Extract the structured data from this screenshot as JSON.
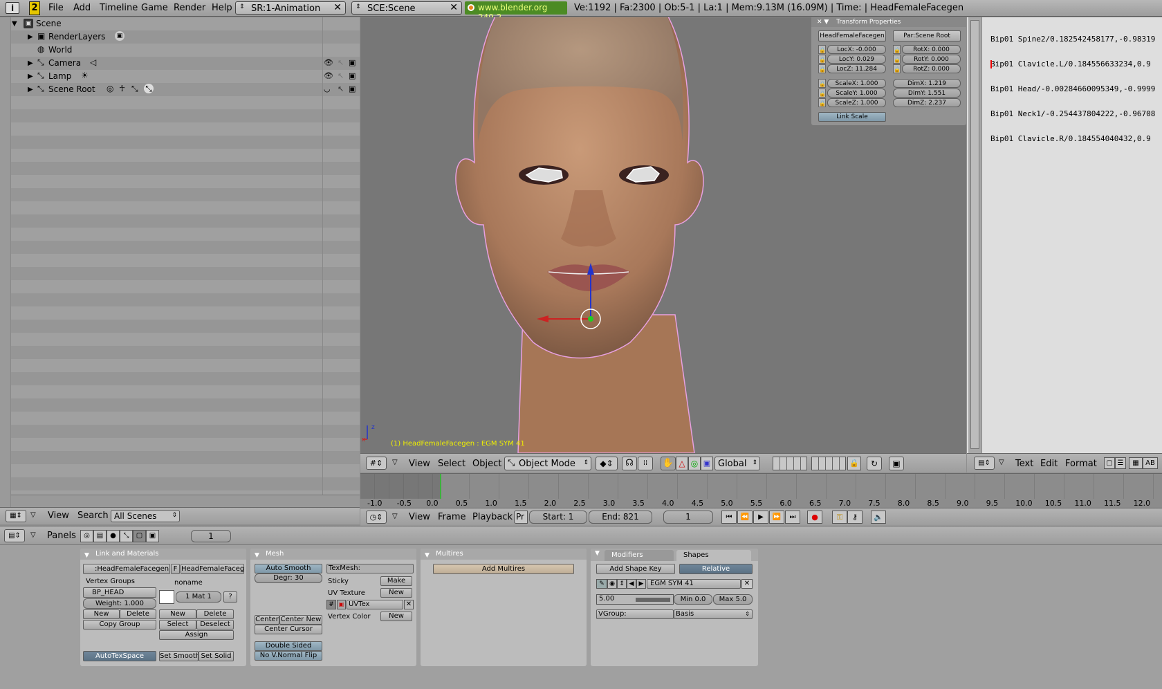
{
  "topbar": {
    "menus": [
      "File",
      "Add",
      "Timeline",
      "Game",
      "Render",
      "Help"
    ],
    "screen": "SR:1-Animation",
    "scene": "SCE:Scene",
    "version": "www.blender.org 249.2",
    "stats": "Ve:1192 | Fa:2300 | Ob:5-1 | La:1  | Mem:9.13M (16.09M)  | Time: | HeadFemaleFacegen"
  },
  "outliner": {
    "scene": "Scene",
    "items": [
      "RenderLayers",
      "World",
      "Camera",
      "Lamp",
      "Scene Root"
    ],
    "header": {
      "view": "View",
      "search": "Search",
      "filter": "All Scenes"
    }
  },
  "viewport": {
    "status": "(1) HeadFemaleFacegen : EGM SYM 41",
    "axis_z": "z",
    "axis_x": "x",
    "header": {
      "view": "View",
      "select": "Select",
      "object": "Object",
      "mode": "Object Mode",
      "orientation": "Global"
    }
  },
  "transform": {
    "title": "Transform Properties",
    "object": "HeadFemaleFacegen",
    "parent": "Par:Scene Root",
    "loc": [
      "LocX: -0.000",
      "LocY: 0.029",
      "LocZ: 11.284"
    ],
    "rot": [
      "RotX: 0.000",
      "RotY: 0.000",
      "RotZ: 0.000"
    ],
    "scale": [
      "ScaleX: 1.000",
      "ScaleY: 1.000",
      "ScaleZ: 1.000"
    ],
    "dim": [
      "DimX: 1.219",
      "DimY: 1.551",
      "DimZ: 2.237"
    ],
    "link_scale": "Link Scale"
  },
  "text_editor": {
    "lines": [
      "Bip01 Spine2/0.182542458177,-0.98319",
      "Bip01 Clavicle.L/0.184556633234,0.9",
      "Bip01 Head/-0.00284660095349,-0.9999",
      "Bip01 Neck1/-0.254437804222,-0.96708",
      "Bip01 Clavicle.R/0.184554040432,0.9"
    ],
    "header": {
      "text": "Text",
      "edit": "Edit",
      "format": "Format",
      "ab": "AB"
    }
  },
  "timeline": {
    "ticks": [
      "-1.0",
      "-0.5",
      "0.0",
      "0.5",
      "1.0",
      "1.5",
      "2.0",
      "2.5",
      "3.0",
      "3.5",
      "4.0",
      "4.5",
      "5.0",
      "5.5",
      "6.0",
      "6.5",
      "7.0",
      "7.5",
      "8.0",
      "8.5",
      "9.0",
      "9.5",
      "10.0",
      "10.5",
      "11.0",
      "11.5",
      "12.0"
    ],
    "current_frame_value": 0.1,
    "header": {
      "view": "View",
      "frame": "Frame",
      "playback": "Playback",
      "pr": "Pr",
      "start": "Start: 1",
      "end": "End: 821",
      "current": "1"
    }
  },
  "buttons_header": {
    "panels": "Panels",
    "frame": "1"
  },
  "link_materials": {
    "title": "Link and Materials",
    "mesh": ":HeadFemaleFacegen",
    "f": "F",
    "object": "HeadFemaleFacegen",
    "vgroups_label": "Vertex Groups",
    "vgroup": "BP_HEAD",
    "weight": "Weight: 1.000",
    "noname": "noname",
    "mat": "1 Mat 1",
    "q": "?",
    "new1": "New",
    "delete1": "Delete",
    "copy_group": "Copy Group",
    "new2": "New",
    "delete2": "Delete",
    "select": "Select",
    "deselect": "Deselect",
    "assign": "Assign",
    "autotex": "AutoTexSpace",
    "set_smooth": "Set Smooth",
    "set_solid": "Set Solid"
  },
  "mesh_panel": {
    "title": "Mesh",
    "auto_smooth": "Auto Smooth",
    "degr": "Degr: 30",
    "texmesh": "TexMesh:",
    "sticky": "Sticky",
    "make": "Make",
    "uv_texture": "UV Texture",
    "new_uv": "New",
    "uvtex": "UVTex",
    "vertex_color": "Vertex Color",
    "new_vc": "New",
    "center": "Center",
    "center_new": "Center New",
    "center_cursor": "Center Cursor",
    "double_sided": "Double Sided",
    "no_vnormal": "No V.Normal Flip"
  },
  "multires": {
    "title": "Multires",
    "add": "Add Multires"
  },
  "shapes": {
    "tab_modifiers": "Modifiers",
    "tab_shapes": "Shapes",
    "add_key": "Add Shape Key",
    "relative": "Relative",
    "key_name": "EGM SYM 41",
    "value": "5.00",
    "min": "Min 0.0",
    "max": "Max 5.0",
    "vgroup": "VGroup:",
    "basis": "Basis"
  }
}
